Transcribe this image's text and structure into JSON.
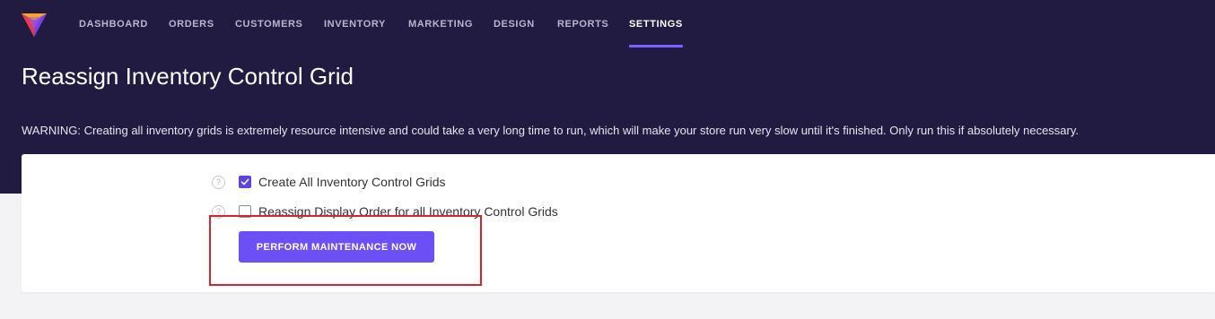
{
  "nav": {
    "items": [
      {
        "label": "DASHBOARD",
        "active": false
      },
      {
        "label": "ORDERS",
        "active": false
      },
      {
        "label": "CUSTOMERS",
        "active": false
      },
      {
        "label": "INVENTORY",
        "active": false
      },
      {
        "label": "MARKETING",
        "active": false
      },
      {
        "label": "DESIGN",
        "active": false
      },
      {
        "label": "REPORTS",
        "active": false
      },
      {
        "label": "SETTINGS",
        "active": true
      }
    ]
  },
  "page": {
    "title": "Reassign Inventory Control Grid",
    "warning": "WARNING: Creating all inventory grids is extremely resource intensive and could take a very long time to run, which will make your store run very slow until it's finished. Only run this if absolutely necessary."
  },
  "options": [
    {
      "label": "Create All Inventory Control Grids",
      "checked": true
    },
    {
      "label": "Reassign Display Order for all Inventory Control Grids",
      "checked": false
    }
  ],
  "action": {
    "button_label": "PERFORM MAINTENANCE NOW"
  },
  "colors": {
    "header_bg": "#211b41",
    "accent": "#6c4ff5",
    "highlight": "#d8232a"
  }
}
